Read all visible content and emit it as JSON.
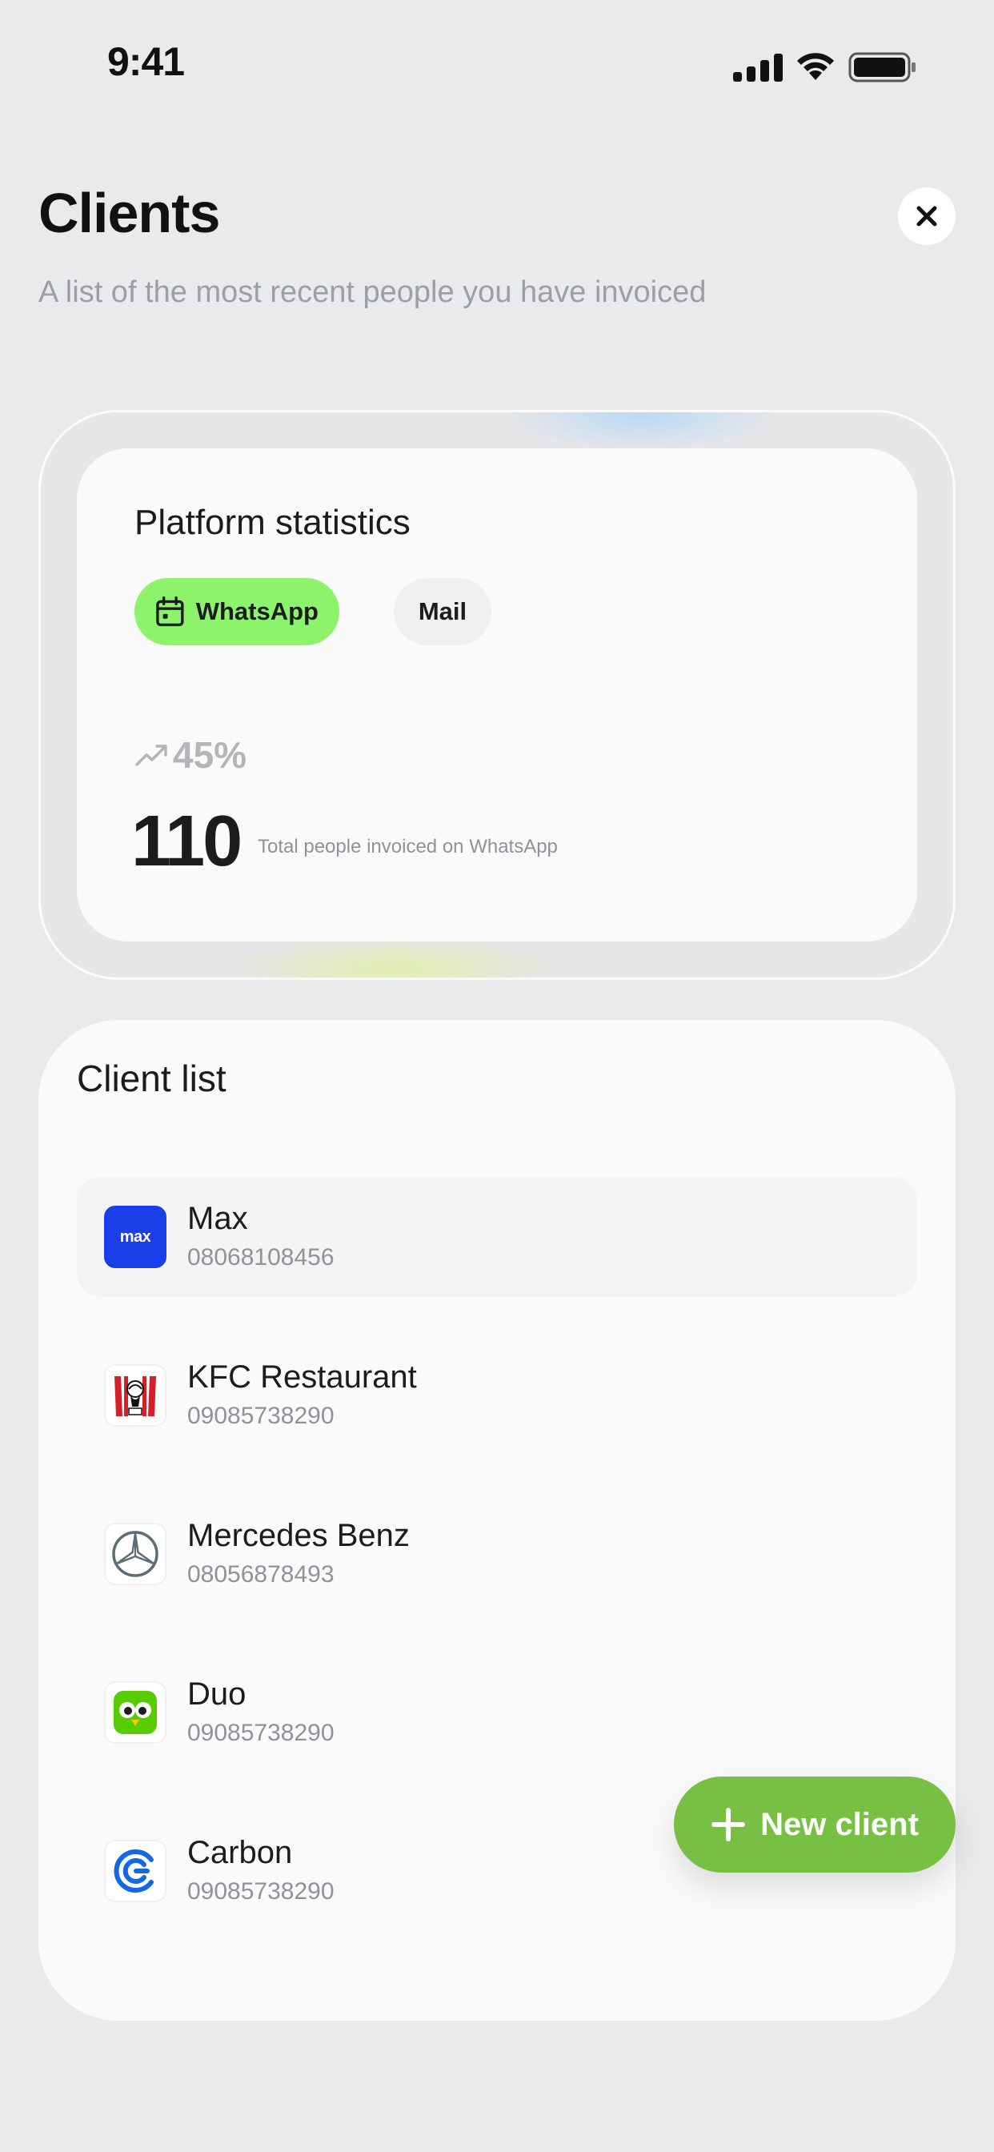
{
  "status_bar": {
    "time": "9:41"
  },
  "header": {
    "title": "Clients",
    "subtitle": "A list of the most recent people you have invoiced"
  },
  "stats": {
    "title": "Platform statistics",
    "tabs": [
      {
        "label": "WhatsApp",
        "selected": true
      },
      {
        "label": "Mail",
        "selected": false
      }
    ],
    "growth": "45%",
    "total": "110",
    "caption": "Total people invoiced on WhatsApp"
  },
  "client_list": {
    "title": "Client list",
    "items": [
      {
        "name": "Max",
        "phone": "08068108456",
        "logo": "max-logo",
        "logo_text": "max",
        "selected": true
      },
      {
        "name": "KFC Restaurant",
        "phone": "09085738290",
        "logo": "kfc-logo"
      },
      {
        "name": "Mercedes Benz",
        "phone": "08056878493",
        "logo": "mercedes-logo"
      },
      {
        "name": "Duo",
        "phone": "09085738290",
        "logo": "duolingo-owl-logo"
      },
      {
        "name": "Carbon",
        "phone": "09085738290",
        "logo": "carbon-logo"
      }
    ]
  },
  "fab": {
    "label": "New client",
    "icon": "plus-icon"
  },
  "colors": {
    "background": "#e9eaec",
    "accent_pill": "#8cf36a",
    "fab": "#77c044",
    "max_blue": "#1a3ee8"
  }
}
